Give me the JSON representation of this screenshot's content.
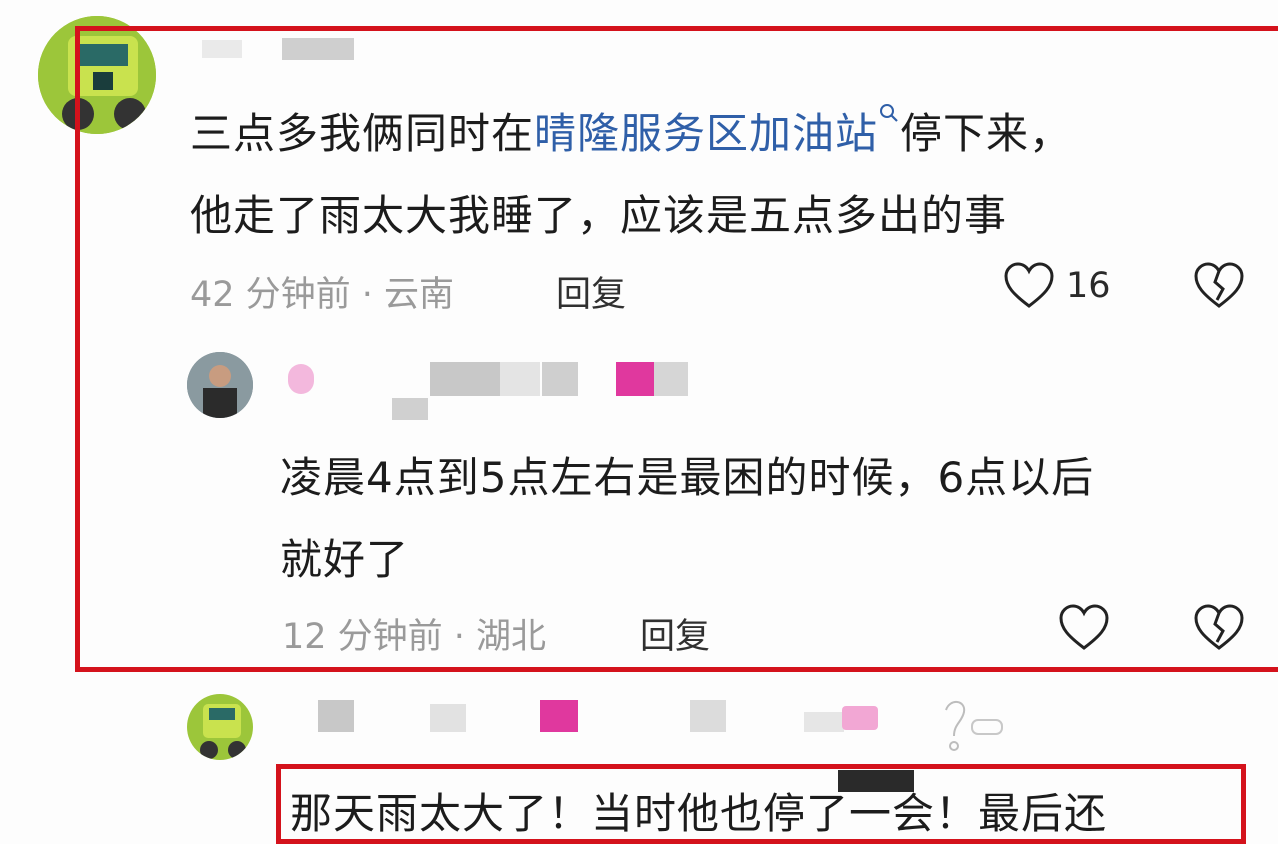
{
  "comment": {
    "text_line1_prefix": "三点多我俩同时在",
    "text_line1_link": "晴隆服务区加油站",
    "text_line1_suffix": "停下来，",
    "text_line2": "他走了雨太大我睡了，应该是五点多出的事",
    "time_location": "42 分钟前 · 云南",
    "reply_label": "回复",
    "like_count": "16"
  },
  "reply": {
    "text_line1": "凌晨4点到5点左右是最困的时候，6点以后",
    "text_line2": "就好了",
    "time_location": "12 分钟前 · 湖北",
    "reply_label": "回复"
  },
  "next_comment": {
    "text_partial": "那天雨太大了！当时他也停了一会！最后还"
  },
  "colors": {
    "highlight_border": "#d4121c",
    "link": "#2f5fa8",
    "meta": "#9a9a9a"
  }
}
